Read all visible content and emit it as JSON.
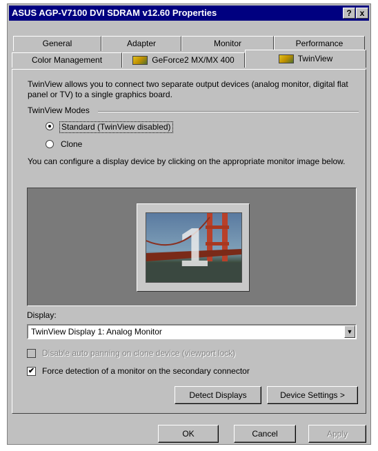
{
  "window": {
    "title": "ASUS AGP-V7100 DVI SDRAM v12.60 Properties",
    "help_label": "?",
    "close_label": "x"
  },
  "tabs_top": [
    {
      "label": "General"
    },
    {
      "label": "Adapter"
    },
    {
      "label": "Monitor"
    },
    {
      "label": "Performance"
    }
  ],
  "tabs_bottom": [
    {
      "label": "Color Management"
    },
    {
      "label": "GeForce2 MX/MX 400",
      "icon": "nvidia-icon"
    },
    {
      "label": "TwinView",
      "icon": "nvidia-icon",
      "active": true
    }
  ],
  "panel": {
    "intro": "TwinView allows you to connect two separate output devices (analog monitor, digital flat panel or TV) to a single graphics board.",
    "modes_group_label": "TwinView Modes",
    "modes": [
      {
        "label": "Standard (TwinView disabled)",
        "checked": true
      },
      {
        "label": "Clone",
        "checked": false
      }
    ],
    "configure_text": "You can configure a display device by clicking on the appropriate monitor image below.",
    "monitor_number": "1",
    "display_label": "Display:",
    "display_value": "TwinView Display 1: Analog Monitor",
    "auto_panning_label": "Disable auto panning on clone device (viewport lock)",
    "force_detection_label": "Force detection of a monitor on the secondary connector",
    "detect_displays_label": "Detect Displays",
    "device_settings_label": "Device Settings >"
  },
  "footer": {
    "ok_label": "OK",
    "cancel_label": "Cancel",
    "apply_label": "Apply"
  },
  "colors": {
    "titlebar": "#000080",
    "face": "#c0c0c0",
    "preview_bg": "#7a7a7a"
  }
}
